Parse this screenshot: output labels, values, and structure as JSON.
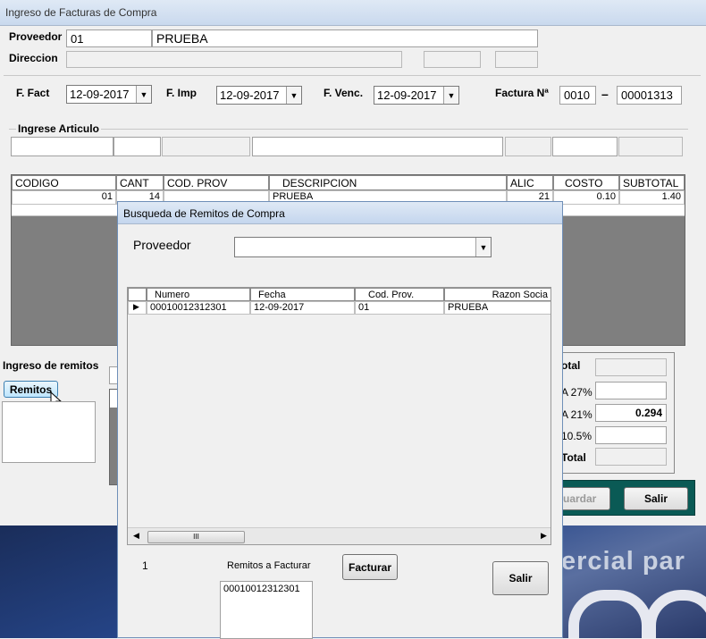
{
  "main_window": {
    "title": "Ingreso de Facturas de Compra",
    "proveedor_label": "Proveedor",
    "proveedor_code": "01",
    "proveedor_name": "PRUEBA",
    "direccion_label": "Direccion",
    "f_fact_label": "F. Fact",
    "f_fact_value": "12-09-2017",
    "f_imp_label": "F. Imp",
    "f_imp_value": "12-09-2017",
    "f_venc_label": "F. Venc.",
    "f_venc_value": "12-09-2017",
    "factura_label": "Factura Nª",
    "factura_pv": "0010",
    "factura_sep": "–",
    "factura_num": "00001313",
    "ingrese_articulo_label": "Ingrese Articulo",
    "grid_headers": [
      "CODIGO",
      "CANT",
      "COD. PROV",
      "DESCRIPCION",
      "ALIC",
      "COSTO",
      "SUBTOTAL"
    ],
    "grid_rows": [
      {
        "codigo": "01",
        "cant": "14",
        "cod_prov": "",
        "descripcion": "PRUEBA",
        "alic": "21",
        "costo": "0.10",
        "subtotal": "1.40"
      }
    ],
    "ingreso_remitos_label": "Ingreso de remitos",
    "remitos_button": "Remitos",
    "totals": {
      "subtotal_label": "otal",
      "iva27_label": "A 27%",
      "iva21_label": "A 21%",
      "iva21_value": "0.294",
      "iva105_label": "10.5%",
      "total_label": "Total"
    },
    "guardar_button": "uardar",
    "salir_button": "Salir",
    "background_text": "ercial par"
  },
  "dialog": {
    "title": "Busqueda de Remitos de Compra",
    "proveedor_label": "Proveedor",
    "proveedor_value": "",
    "grid_headers": [
      "Numero",
      "Fecha",
      "Cod. Prov.",
      "Razon Socia"
    ],
    "grid_rows": [
      {
        "numero": "00010012312301",
        "fecha": "12-09-2017",
        "cod_prov": "01",
        "razon": "PRUEBA"
      }
    ],
    "scroll_grip": "III",
    "count": "1",
    "remitos_a_facturar_label": "Remitos a Facturar",
    "remitos_list": [
      "00010012312301"
    ],
    "facturar_button": "Facturar",
    "salir_button": "Salir"
  }
}
